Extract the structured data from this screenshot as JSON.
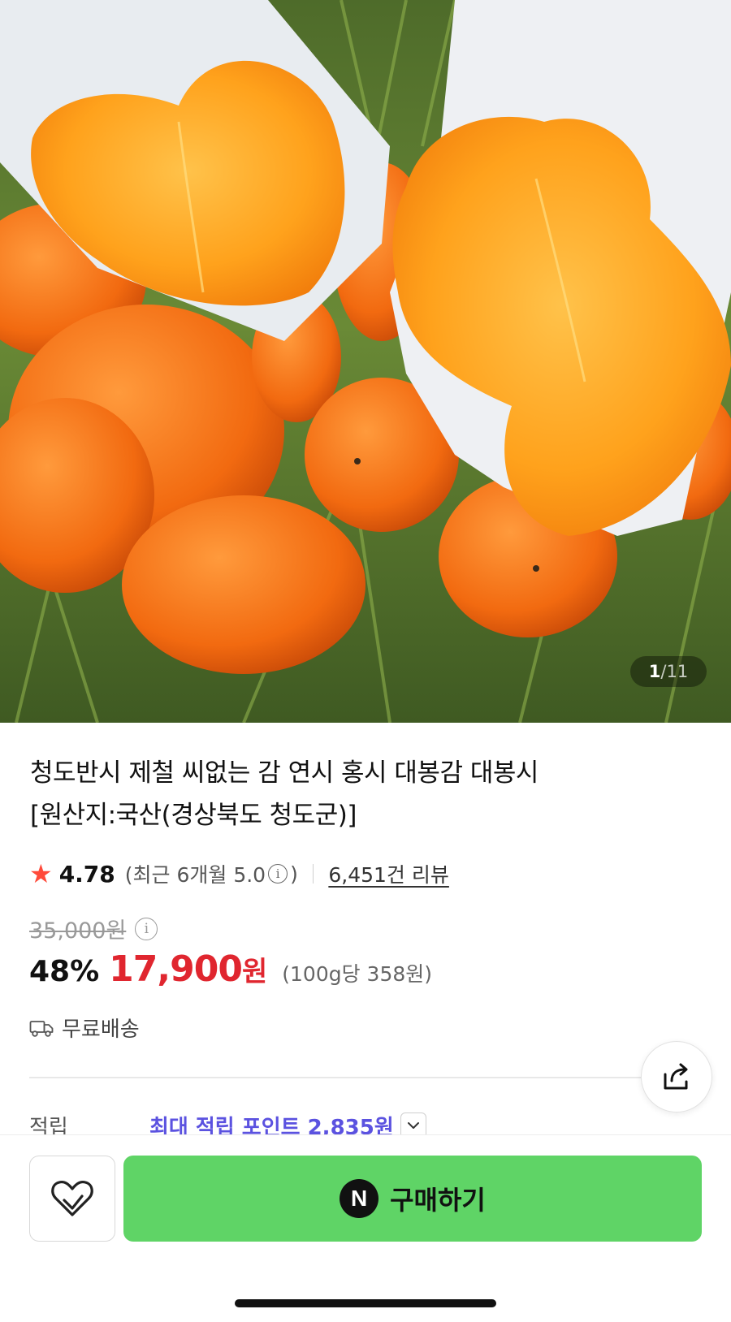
{
  "product": {
    "title_line1": "청도반시 제철 씨없는 감 연시 홍시 대봉감 대봉시",
    "title_line2": "[원산지:국산(경상북도 청도군)]",
    "image_counter": {
      "current": "1",
      "separator": "/",
      "total": "11"
    }
  },
  "rating": {
    "score": "4.78",
    "recent_prefix": "(최근 6개월 5.0",
    "recent_suffix": ")",
    "review_count_text": "6,451건 리뷰",
    "star_color": "#ff4a3a"
  },
  "price": {
    "original": "35,000원",
    "discount_rate": "48%",
    "sale_price": "17,900",
    "sale_currency": "원",
    "unit_price": "(100g당 358원)",
    "sale_color": "#e0262f"
  },
  "shipping": {
    "label": "무료배송"
  },
  "points": {
    "label": "적립",
    "value": "최대 적립 포인트 2,835원",
    "color": "#5b52e0"
  },
  "actions": {
    "buy_label": "구매하기",
    "npay_logo": "N",
    "buy_color": "#5fd466"
  },
  "icons": [
    "star-icon",
    "info-icon",
    "truck-icon",
    "share-icon",
    "chevron-down-icon",
    "heart-icon",
    "npay-icon"
  ]
}
